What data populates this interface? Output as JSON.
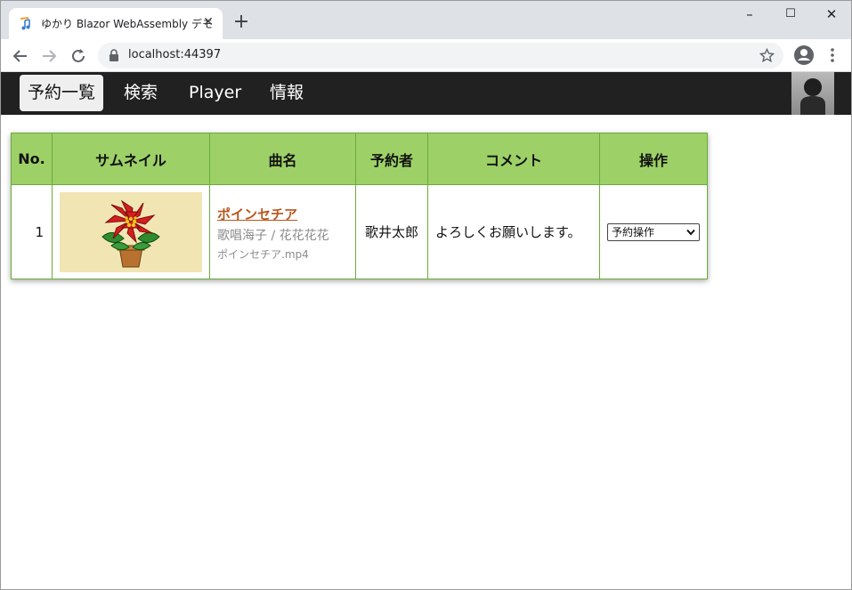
{
  "browser": {
    "tab_title": "ゆかり Blazor WebAssembly デモ",
    "tab_close": "✕",
    "new_tab": "+",
    "url": "localhost:44397",
    "window_minimize": "–",
    "window_maximize": "☐",
    "window_close": "✕"
  },
  "nav": {
    "items": [
      {
        "label": "予約一覧",
        "active": true
      },
      {
        "label": "検索",
        "active": false
      },
      {
        "label": "Player",
        "active": false
      },
      {
        "label": "情報",
        "active": false
      }
    ]
  },
  "table": {
    "headers": [
      "No.",
      "サムネイル",
      "曲名",
      "予約者",
      "コメント",
      "操作"
    ],
    "rows": [
      {
        "no": "1",
        "song_title": "ポインセチア",
        "artist": "歌唱海子 / 花花花花",
        "file": "ポインセチア.mp4",
        "user": "歌井太郎",
        "comment": "よろしくお願いします。",
        "operation": "予約操作"
      }
    ]
  },
  "colors": {
    "header_bg": "#9dd167",
    "border": "#6aab3a",
    "song_link": "#b8561d",
    "nav_bg": "#212121"
  },
  "icons": [
    "music-note-icon",
    "close-icon",
    "plus-icon",
    "back-arrow-icon",
    "forward-arrow-icon",
    "reload-icon",
    "lock-icon",
    "star-icon",
    "profile-icon",
    "menu-dots-icon",
    "chevron-down-icon",
    "user-avatar-icon",
    "poinsettia-thumbnail"
  ]
}
